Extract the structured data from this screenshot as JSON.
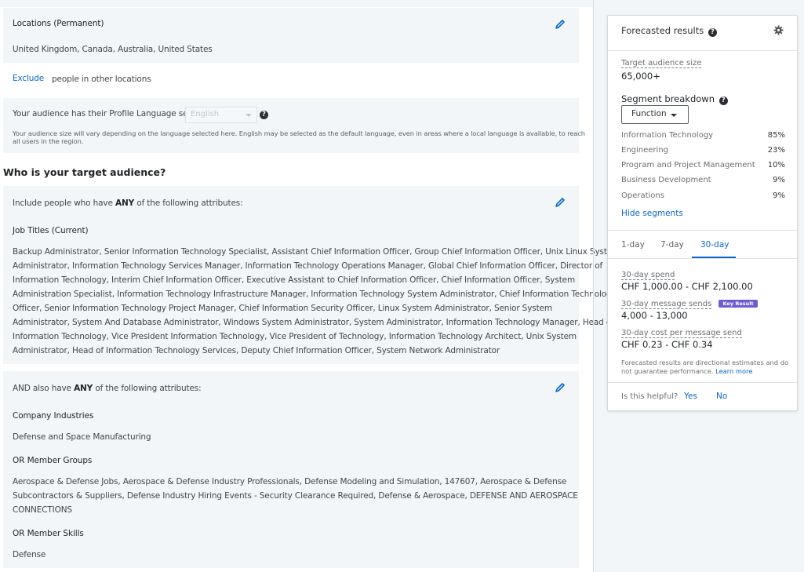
{
  "locations": {
    "heading": "Locations (Permanent)",
    "value": "United Kingdom, Canada, Australia, United States",
    "exclude_label": "Exclude",
    "exclude_text": "people in other locations"
  },
  "language": {
    "prefix": "Your audience has their Profile Language set to",
    "selected": "English",
    "note_line1": "Your audience size will vary depending on the language selected here. English may be selected as the default language, even in areas where a local language is available, to reach",
    "note_line2": "all users in the region."
  },
  "audience": {
    "heading": "Who is your target audience?",
    "include_pre": "Include people who have",
    "include_any": "ANY",
    "include_post": "of the following attributes:",
    "job_titles_heading": "Job Titles (Current)",
    "job_titles_lines": [
      "Backup Administrator, Senior Information Technology Specialist, Assistant Chief Information Officer, Group Chief Information Officer, Unix Linux System",
      "Administrator, Information Technology Services Manager, Information Technology Operations Manager, Global Chief Information Officer, Director of",
      "Information Technology, Interim Chief Information Officer, Executive Assistant to Chief Information Officer, Chief Information Officer, System",
      "Administration Specialist, Information Technology Infrastructure Manager, Information Technology System Administrator, Chief Information Technology",
      "Officer, Senior Information Technology Project Manager, Chief Information Security Officer, Linux System Administrator, Senior System",
      "Administrator, System And Database Administrator, Windows System Administrator, System Administrator, Information Technology Manager, Head of",
      "Information Technology, Vice President Information Technology, Vice President of Technology, Information Technology Architect, Unix System",
      "Administrator, Head of Information Technology Services, Deputy Chief Information Officer, System Network Administrator"
    ],
    "and_pre": "AND also have",
    "and_any": "ANY",
    "and_post": "of the following attributes:",
    "industries_heading": "Company Industries",
    "industries_value": "Defense and Space Manufacturing",
    "groups_heading": "OR Member Groups",
    "groups_lines": [
      "Aerospace & Defense Jobs, Aerospace & Defense Industry Professionals, Defense Modeling and Simulation, 147607, Aerospace & Defense",
      "Subcontractors & Suppliers, Defense Industry Hiring Events - Security Clearance Required, Defense & Aerospace, DEFENSE AND AEROSPACE",
      "CONNECTIONS"
    ],
    "skills_heading": "OR Member Skills",
    "skills_value": "Defense"
  },
  "forecast": {
    "title": "Forecasted results",
    "audience_size_label": "Target audience size",
    "audience_size_value": "65,000+",
    "segment_heading": "Segment breakdown",
    "segment_button": "Function",
    "segments": [
      {
        "name": "Information Technology",
        "pct": "85%"
      },
      {
        "name": "Engineering",
        "pct": "23%"
      },
      {
        "name": "Program and Project Management",
        "pct": "10%"
      },
      {
        "name": "Business Development",
        "pct": "9%"
      },
      {
        "name": "Operations",
        "pct": "9%"
      }
    ],
    "hide_segments": "Hide segments",
    "tabs": [
      "1-day",
      "7-day",
      "30-day"
    ],
    "active_tab": "30-day",
    "spend_label": "30-day spend",
    "spend_value": "CHF 1,000.00 - CHF 2,100.00",
    "sends_label": "30-day message sends",
    "sends_badge": "Key Result",
    "sends_value": "4,000 - 13,000",
    "cost_label": "30-day cost per message send",
    "cost_value": "CHF 0.23 - CHF 0.34",
    "disclaimer_line1": "Forecasted results are directional estimates and do",
    "disclaimer_line2": "not guarantee performance.",
    "learn_more": "Learn more",
    "helpful_q": "Is this helpful?",
    "yes": "Yes",
    "no": "No"
  },
  "colors": {
    "accent": "#0a66c2",
    "badge": "#6e5bd1",
    "panel_bg": "#f3f6f8"
  }
}
